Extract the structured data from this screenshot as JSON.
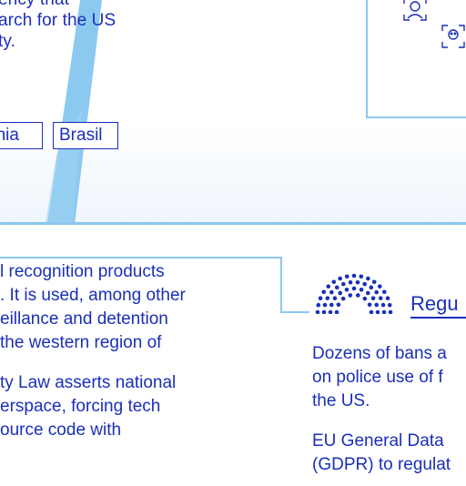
{
  "story": {
    "lines": [
      "ency that",
      "arch for the US",
      "ty."
    ]
  },
  "tags": {
    "armenia": "enia",
    "brasil": "Brasil"
  },
  "icons": {
    "face_scan": "face-scan-icon",
    "parliament": "parliament-icon"
  },
  "lower_left": {
    "para1": [
      "l recognition products",
      ". It is used, among other",
      "eillance and detention",
      "the western region of"
    ],
    "para2": [
      "ty Law asserts national",
      "erspace, forcing tech",
      "ource code with"
    ]
  },
  "regulation": {
    "title": "Regu"
  },
  "right_text": {
    "para1": [
      "Dozens of bans a",
      "on police use of f",
      "the US."
    ],
    "para2": [
      "EU General Data",
      "(GDPR) to regulat"
    ]
  },
  "colors": {
    "text": "#1a2fb8",
    "accent_light": "#8cc7ef",
    "ribbon": "#7fc3f0"
  }
}
